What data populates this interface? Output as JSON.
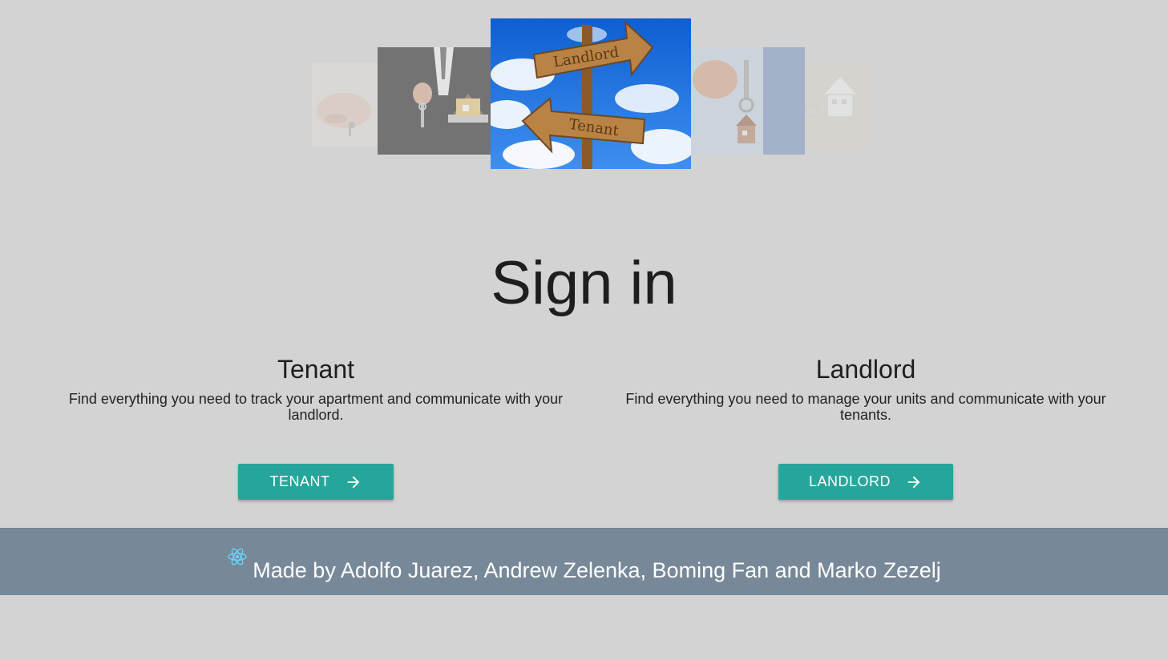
{
  "carousel": {
    "slides": [
      {
        "name": "hands-keys-photo"
      },
      {
        "name": "businessman-keys-house-photo"
      },
      {
        "name": "landlord-tenant-signpost-photo",
        "sign_top": "Landlord",
        "sign_bottom": "Tenant"
      },
      {
        "name": "hand-key-house-keychain-photo"
      },
      {
        "name": "house-keychain-photo"
      }
    ]
  },
  "page": {
    "title": "Sign in"
  },
  "tenant": {
    "heading": "Tenant",
    "description": "Find everything you need to track your apartment and communicate with your landlord.",
    "button_label": "TENANT",
    "button_icon": "arrow-right-icon"
  },
  "landlord": {
    "heading": "Landlord",
    "description": "Find everything you need to manage your units and communicate with your tenants.",
    "button_label": "LANDLORD",
    "button_icon": "arrow-right-icon"
  },
  "footer": {
    "icon": "react-icon",
    "text": "Made by Adolfo Juarez, Andrew Zelenka, Boming Fan and Marko Zezelj"
  },
  "colors": {
    "background": "#d3d3d3",
    "accent": "#26a69a",
    "footer": "#778899"
  }
}
